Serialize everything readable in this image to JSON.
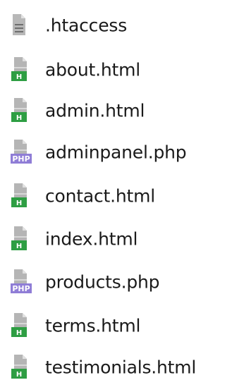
{
  "colors": {
    "html_badge": "#2e9e43",
    "php_badge": "#8f7dd6",
    "page_gray": "#9a9a9a"
  },
  "files": [
    {
      "name": ".htaccess",
      "icon": "generic-file-icon",
      "badge": ""
    },
    {
      "name": "about.html",
      "icon": "html-file-icon",
      "badge": "H"
    },
    {
      "name": "admin.html",
      "icon": "html-file-icon",
      "badge": "H"
    },
    {
      "name": "adminpanel.php",
      "icon": "php-file-icon",
      "badge": "PHP"
    },
    {
      "name": "contact.html",
      "icon": "html-file-icon",
      "badge": "H"
    },
    {
      "name": "index.html",
      "icon": "html-file-icon",
      "badge": "H"
    },
    {
      "name": "products.php",
      "icon": "php-file-icon",
      "badge": "PHP"
    },
    {
      "name": "terms.html",
      "icon": "html-file-icon",
      "badge": "H"
    },
    {
      "name": "testimonials.html",
      "icon": "html-file-icon",
      "badge": "H"
    }
  ]
}
